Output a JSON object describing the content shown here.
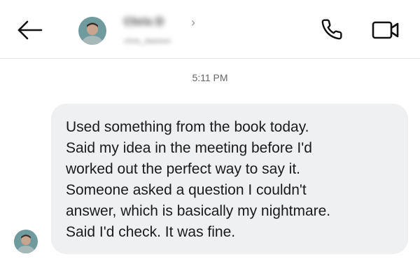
{
  "header": {
    "contact_name": "Chris D",
    "contact_subtitle": "chris_dawson",
    "icons": {
      "back": "arrow-left-icon",
      "call": "phone-icon",
      "video": "video-camera-icon",
      "chevron": "chevron-right-icon"
    }
  },
  "conversation": {
    "timestamp": "5:11 PM",
    "messages": [
      {
        "sender": "contact",
        "text": "Used something from the book today.\nSaid my idea in the meeting before I'd\nworked out the perfect way to say it.\nSomeone asked a question I couldn't\nanswer, which is basically my nightmare.\nSaid I'd check. It was fine."
      }
    ]
  },
  "colors": {
    "bubble_bg": "#eff0f2",
    "divider": "#e6e6e6",
    "timestamp": "#666666"
  }
}
